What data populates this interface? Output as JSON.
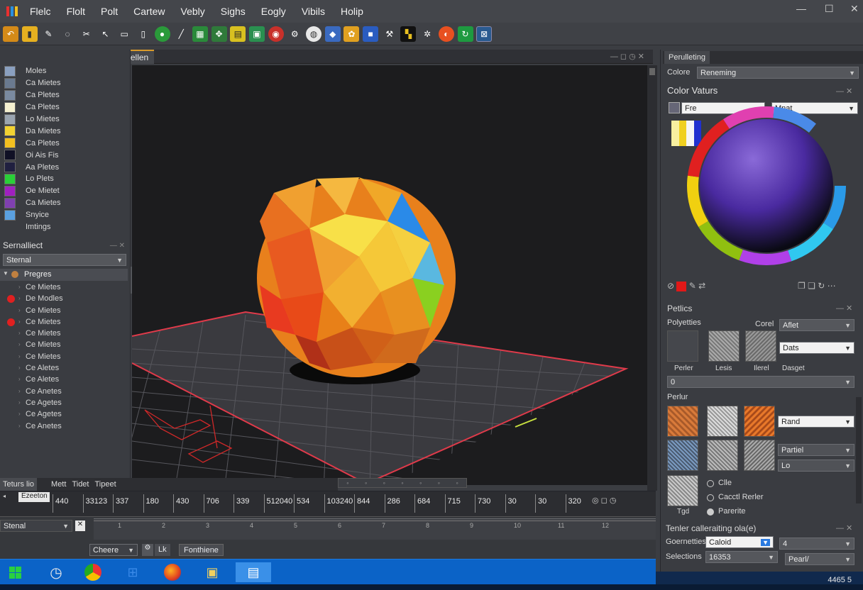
{
  "menu": {
    "items": [
      "Flelc",
      "Flolt",
      "Polt",
      "Cartew",
      "Vebly",
      "Sighs",
      "Eogly",
      "Vibils",
      "Holip"
    ]
  },
  "doc": {
    "title": "Purceting Ro Ther Mocingction Pellen"
  },
  "materials": [
    {
      "label": "Moles",
      "color": "#8aa0c0"
    },
    {
      "label": "Ca Mietes",
      "color": "#6a7a90"
    },
    {
      "label": "Ca Pletes",
      "color": "#7a8aa0"
    },
    {
      "label": "Ca Pletes",
      "color": "#f5f0d0"
    },
    {
      "label": "Lo Mietes",
      "color": "#9aa4b0"
    },
    {
      "label": "Da Mietes",
      "color": "#f2d232"
    },
    {
      "label": "Ca Pletes",
      "color": "#f3c020"
    },
    {
      "label": "Oi Ais Fis",
      "color": "#101025"
    },
    {
      "label": "Aa Pletes",
      "color": "#202040"
    },
    {
      "label": "Lo Plets",
      "color": "#2ad038"
    },
    {
      "label": "Oe Mietet",
      "color": "#a020c0"
    },
    {
      "label": "Ca Mietes",
      "color": "#8040b0"
    },
    {
      "label": "Snyice",
      "color": "#5aa0e0"
    },
    {
      "label": "Imtings",
      "color": ""
    }
  ],
  "scene": {
    "header": "Sernalliect",
    "filter": "Sternal",
    "root": "Pregres",
    "items": [
      {
        "label": "Ce Mietes",
        "dot": false
      },
      {
        "label": "De Modles",
        "dot": true
      },
      {
        "label": "Ce Mietes",
        "dot": false
      },
      {
        "label": "Ce Mietes",
        "dot": true
      },
      {
        "label": "Ce Mietes",
        "dot": false
      },
      {
        "label": "Ce Mietes",
        "dot": false
      },
      {
        "label": "Ce Mietes",
        "dot": false
      },
      {
        "label": "Ce Aletes",
        "dot": false
      },
      {
        "label": "Ce Aletes",
        "dot": false
      },
      {
        "label": "Ce Anetes",
        "dot": false
      },
      {
        "label": "Ce Agetes",
        "dot": false
      },
      {
        "label": "Ce Agetes",
        "dot": false
      },
      {
        "label": "Ce Anetes",
        "dot": false
      }
    ]
  },
  "timeline": {
    "tabs": [
      "Teturs lio",
      "Mett",
      "Tidet",
      "Tipeet"
    ],
    "name_field": "Ezeeton",
    "ruler": [
      "440",
      "33123",
      "337",
      "180",
      "430",
      "706",
      "339",
      "512040",
      "534",
      "103240",
      "844",
      "286",
      "684",
      "715",
      "730",
      "30",
      "30",
      "320"
    ],
    "frames": [
      "1",
      "2",
      "3",
      "4",
      "5",
      "6",
      "7",
      "8",
      "9",
      "10",
      "11",
      "12"
    ],
    "layer": "Stenal",
    "bottom": [
      "Cheere",
      "Lk",
      "Fonthiene"
    ]
  },
  "right": {
    "tab": "Perulleting",
    "color_label": "Colore",
    "color_value": "Reneming",
    "color_header": "Color Vaturs",
    "field1": "Fre",
    "field2": "Mnat",
    "textures_header": "Petlics",
    "palettes_label": "Polyetties",
    "corel_label": "Corel",
    "corel_value": "Aflet",
    "dats_value": "Dats",
    "thumbs_labels": [
      "Perler",
      "Lesis",
      "Ilerel",
      "Dasget"
    ],
    "count_value": "0",
    "feature_label": "Perlur",
    "drop_rand": "Rand",
    "drop_partial": "Partiel",
    "drop_lo": "Lo",
    "tex_label": "Tgd",
    "radio": [
      "Clle",
      "Cacctl Rerler",
      "Parerite"
    ],
    "settings_header": "Tenler calleraiting ola(e)",
    "lbl_geometries": "Goernetties",
    "val_geometries": "Caloid",
    "lbl_selections": "Selections",
    "val_selections": "16353",
    "val_pearl": "Pearl/",
    "val_right_dd": "4"
  },
  "taskbar": {
    "clock": "4465 5"
  },
  "colors": {
    "accent": "#d99a2a",
    "taskbar": "#0b63c7",
    "viewport": "#1c1c1e",
    "grid_edge": "#e03a4a"
  }
}
